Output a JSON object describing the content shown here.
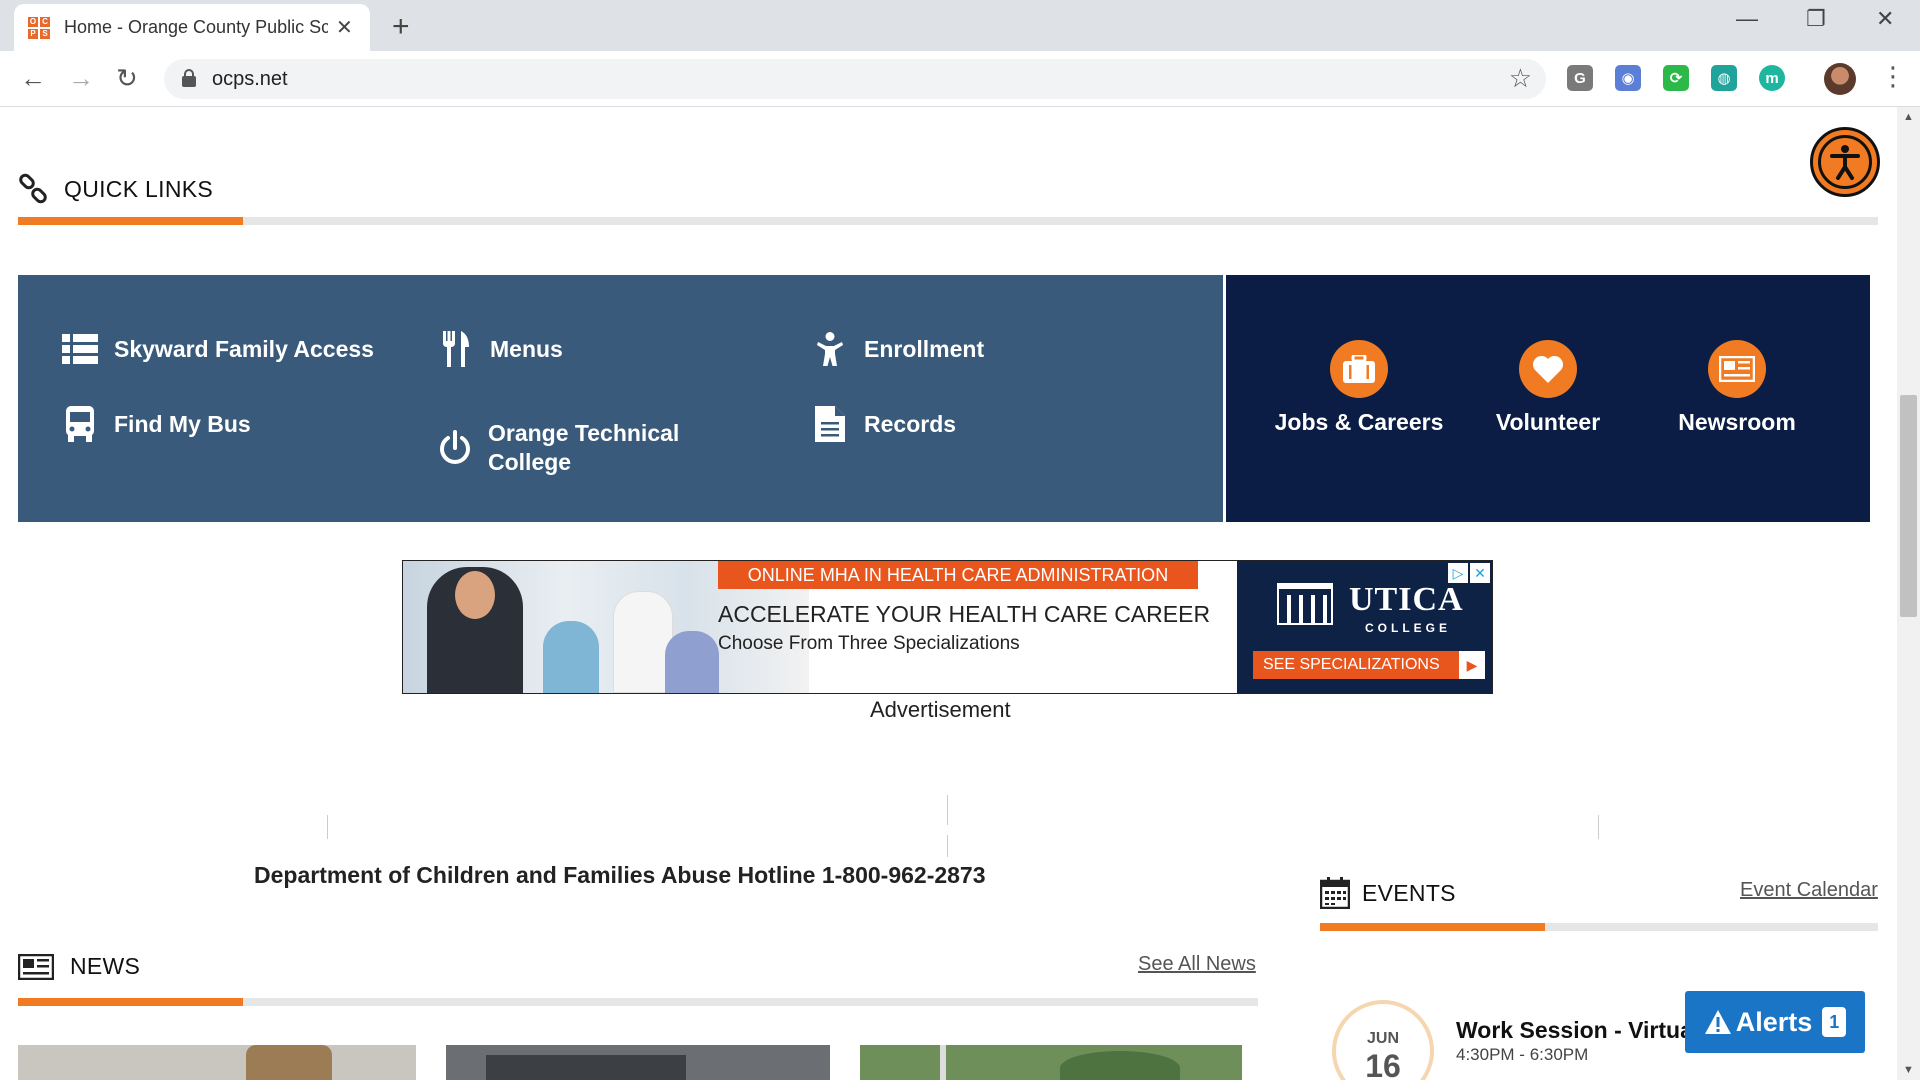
{
  "browser": {
    "tab_title": "Home - Orange County Public Sc",
    "favicon_letters": [
      "O",
      "C",
      "P",
      "S"
    ],
    "url": "ocps.net",
    "extensions": [
      {
        "name": "g-extension-icon",
        "label": "G",
        "color": "#7a7a7a"
      },
      {
        "name": "camera-extension-icon",
        "label": "◉",
        "color": "#5b7fd6"
      },
      {
        "name": "refresh-extension-icon",
        "label": "⟳",
        "color": "#2db84a"
      },
      {
        "name": "globe-extension-icon",
        "label": "◍",
        "color": "#1fa39b"
      },
      {
        "name": "m-extension-icon",
        "label": "m",
        "color": "#1fb6a0"
      }
    ]
  },
  "quick_links": {
    "title": "QUICK LINKS",
    "items": [
      {
        "label": "Skyward Family Access",
        "icon": "list-icon"
      },
      {
        "label": "Menus",
        "icon": "utensils-icon"
      },
      {
        "label": "Enrollment",
        "icon": "child-icon"
      },
      {
        "label": "Find My Bus",
        "icon": "bus-icon"
      },
      {
        "label": "Orange Technical College",
        "icon": "power-icon"
      },
      {
        "label": "Records",
        "icon": "document-icon"
      }
    ],
    "circle_links": [
      {
        "label": "Jobs & Careers",
        "icon": "briefcase-icon"
      },
      {
        "label": "Volunteer",
        "icon": "heart-icon"
      },
      {
        "label": "Newsroom",
        "icon": "newspaper-icon"
      }
    ]
  },
  "ad": {
    "banner": "ONLINE MHA IN HEALTH CARE ADMINISTRATION",
    "headline": "ACCELERATE YOUR HEALTH CARE CAREER",
    "subline": "Choose From Three Specializations",
    "brand_name": "UTICA",
    "brand_sub": "COLLEGE",
    "cta": "SEE SPECIALIZATIONS",
    "label": "Advertisement"
  },
  "hotline": "Department of Children and Families Abuse Hotline 1-800-962-2873",
  "news": {
    "title": "NEWS",
    "see_all": "See All News"
  },
  "events": {
    "title": "EVENTS",
    "calendar_link": "Event Calendar",
    "items": [
      {
        "month": "JUN",
        "day": "16",
        "title": "Work Session - Virtual",
        "time": "4:30PM - 6:30PM"
      }
    ]
  },
  "alerts": {
    "label": "Alerts",
    "count": "1"
  },
  "colors": {
    "accent": "#f07b22",
    "quick_links_bg": "#3a5a7b",
    "navy": "#0b1d44",
    "alerts_bg": "#1a75c7"
  }
}
